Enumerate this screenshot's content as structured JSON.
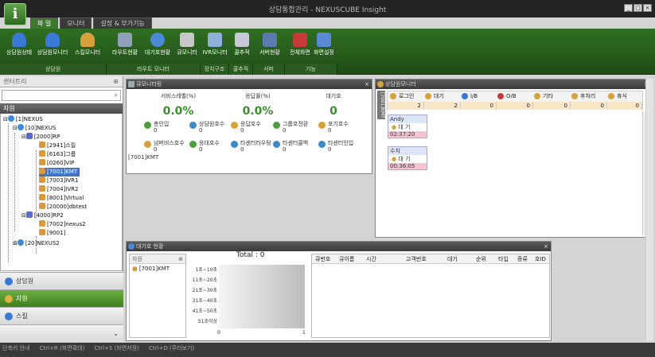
{
  "app": {
    "title": "상담통합관리 - NEXUSCUBE Insight",
    "icon_letter": "i"
  },
  "window_controls": [
    "_",
    "□",
    "×"
  ],
  "tabs": [
    {
      "label": "파 일",
      "active": true
    },
    {
      "label": "모니터",
      "active": false
    },
    {
      "label": "설정 & 부가기능",
      "active": false
    }
  ],
  "ribbon": {
    "buttons": [
      {
        "label": "상담원상태",
        "color": "#3a7ad6"
      },
      {
        "label": "상담원모니터",
        "color": "#3a7ad6"
      },
      {
        "label": "스킬모니터",
        "color": "#d6a13a"
      },
      {
        "label": "라우트현황",
        "color": "#8fa0b8"
      },
      {
        "label": "대기호현황",
        "color": "#4a8ad6"
      },
      {
        "label": "큐모니터",
        "color": "#c8c8c8"
      },
      {
        "label": "IVR모니터",
        "color": "#8fb0d8"
      },
      {
        "label": "콜추적",
        "color": "#c8c8d8"
      },
      {
        "label": "서버현황",
        "color": "#5a7ab0"
      },
      {
        "label": "전체화면",
        "color": "#c83a3a"
      },
      {
        "label": "화면설정",
        "color": "#5a8ad6"
      }
    ],
    "groups": [
      {
        "label": "상담원"
      },
      {
        "label": "라우트 모니터"
      },
      {
        "label": "장치구조"
      },
      {
        "label": "콜추적"
      },
      {
        "label": "서버"
      },
      {
        "label": "기능"
      }
    ]
  },
  "left_panel": {
    "header": "센터트리",
    "pin_icon": "pin-icon",
    "search_placeholder": "",
    "section": "자원",
    "tree": [
      {
        "label": "[1]NEXUS",
        "icon_color": "#3c8ad8"
      },
      {
        "label": "[10]NEXUS",
        "icon_color": "#3c8ad8"
      },
      {
        "label": "[2000]RP",
        "icon_color": "#5a6ad0"
      },
      {
        "label": "[2941]스킬",
        "icon_color": "#d89a3c"
      },
      {
        "label": "[6163]그룹",
        "icon_color": "#d89a3c"
      },
      {
        "label": "[0260]VIP",
        "icon_color": "#d89a3c"
      },
      {
        "label": "[7001]KMT",
        "icon_color": "#d89a3c",
        "selected": true
      },
      {
        "label": "[7003]IVR1",
        "icon_color": "#d89a3c"
      },
      {
        "label": "[7004]IVR2",
        "icon_color": "#d89a3c"
      },
      {
        "label": "[8001]Virtual",
        "icon_color": "#d89a3c"
      },
      {
        "label": "[20000]dbtest",
        "icon_color": "#d89a3c"
      },
      {
        "label": "[4000]RP2",
        "icon_color": "#5a6ad0"
      },
      {
        "label": "[7002]nexus2",
        "icon_color": "#d89a3c"
      },
      {
        "label": "[9001]",
        "icon_color": "#d89a3c"
      },
      {
        "label": "[20]NEXUS2",
        "icon_color": "#3c8ad8"
      }
    ],
    "nav": [
      {
        "label": "상담원",
        "active": false,
        "color": "#3a7ad6"
      },
      {
        "label": "자원",
        "active": true,
        "color": "#e0b040"
      },
      {
        "label": "스킬",
        "active": false,
        "color": "#3a7ad6"
      }
    ]
  },
  "service_panel": {
    "title": "큐모니터링",
    "stats": [
      {
        "label": "서비스레벨(%)",
        "value": "0.0%"
      },
      {
        "label": "응답률(%)",
        "value": "0.0%"
      },
      {
        "label": "대기호",
        "value": "0"
      }
    ],
    "metrics": [
      {
        "label": "총인입",
        "value": "0",
        "color": "#4aa03a"
      },
      {
        "label": "상담원호수",
        "value": "0",
        "color": "#3a8ac8"
      },
      {
        "label": "응답호수",
        "value": "0",
        "color": "#d8a03a"
      },
      {
        "label": "그룹호전환",
        "value": "0",
        "color": "#4aa03a"
      },
      {
        "label": "포기호수",
        "value": "0",
        "color": "#d8a03a"
      },
      {
        "label": "넘버비스호수",
        "value": "0",
        "color": "#d8a03a"
      },
      {
        "label": "응대호수",
        "value": "0",
        "color": "#4aa03a"
      },
      {
        "label": "타센터라우팅",
        "value": "0",
        "color": "#3a8ac8"
      },
      {
        "label": "타센터콜백",
        "value": "0",
        "color": "#3a8ac8"
      },
      {
        "label": "타센터인입",
        "value": "0",
        "color": "#3a8ac8"
      }
    ],
    "footer": "[7001]KMT"
  },
  "agent_panel": {
    "title": "상담원모니터",
    "side_label": "[7001]KMT",
    "states": [
      {
        "label": "로그인",
        "count": "2",
        "color": "#d8a03a"
      },
      {
        "label": "대기",
        "count": "2",
        "color": "#d8a03a"
      },
      {
        "label": "I/B",
        "count": "0",
        "color": "#3a7ad6"
      },
      {
        "label": "O/B",
        "count": "0",
        "color": "#c83a3a"
      },
      {
        "label": "기타",
        "count": "0",
        "color": "#d8a03a"
      },
      {
        "label": "후처리",
        "count": "0",
        "color": "#d8a03a"
      },
      {
        "label": "휴식",
        "count": "0",
        "color": "#d8a03a"
      }
    ],
    "agents": [
      {
        "name": "Andy",
        "state": "대 기",
        "time": "02:37:20"
      },
      {
        "name": "수지",
        "state": "대 기",
        "time": "00:36:05"
      }
    ]
  },
  "queue_panel": {
    "title": "대기호 현황",
    "list_header": "자원",
    "list_items": [
      "[7001]KMT"
    ],
    "total_label": "Total",
    "total_value": "0",
    "buckets": [
      "1초~10초",
      "11초~20초",
      "21초~30초",
      "31초~40초",
      "41초~50초",
      "51초이상"
    ],
    "axis_ticks": [
      "0",
      "1"
    ],
    "table_headers": [
      "큐번호",
      "큐이름",
      "시간",
      "고객번호",
      "대기",
      "순위",
      "타입",
      "종류",
      "호ID"
    ]
  },
  "statusbar": {
    "items": [
      "단축키 안내",
      "Ctrl+R (화면확대)",
      "Ctrl+S (화면저장)",
      "Ctrl+D (루터보기)"
    ]
  },
  "colors": {
    "ribbon": "#2f6e22",
    "accent_green": "#3b8d2f",
    "selection": "#3f75c9"
  }
}
